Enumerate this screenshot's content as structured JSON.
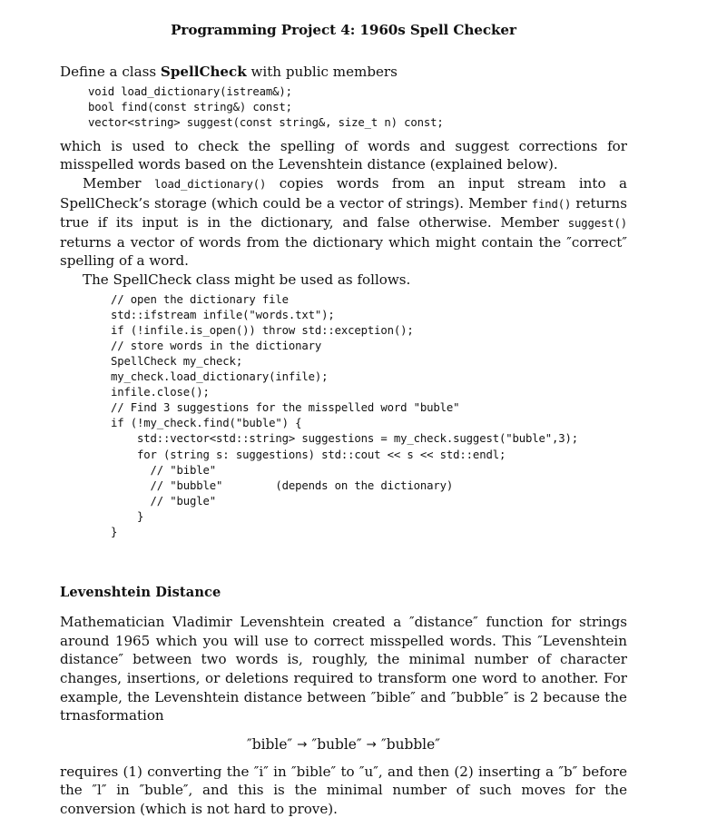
{
  "document": {
    "title": "Programming Project 4: 1960s Spell Checker",
    "intro": {
      "line": "Define a class SpellCheck with public members",
      "lead_prefix": "Define a class ",
      "lead_class_name": "SpellCheck",
      "lead_suffix": " with public members"
    },
    "signature_code": "void load_dictionary(istream&);\nbool find(const string&) const;\nvector<string> suggest(const string&, size_t n) const;",
    "paragraph_which": "which is used to check the spelling of words and suggest corrections for misspelled words based on the Levenshtein distance (explained below).",
    "paragraph_members": {
      "part1": "Member ",
      "code1": "load_dictionary()",
      "part2": " copies words from an input stream into a SpellCheck’s storage (which could be a vector of strings).  Member ",
      "code2": "find()",
      "part3": " returns true if its input is in the dictionary, and false otherwise. Member ",
      "code3": "suggest()",
      "part4": " returns a vector of words from the dictionary which might contain the ″correct″ spelling of a word."
    },
    "paragraph_usage": "The SpellCheck class might be used as follows.",
    "usage_code": "// open the dictionary file\nstd::ifstream infile(\"words.txt\");\nif (!infile.is_open()) throw std::exception();\n// store words in the dictionary\nSpellCheck my_check;\nmy_check.load_dictionary(infile);\ninfile.close();\n// Find 3 suggestions for the misspelled word \"buble\"\nif (!my_check.find(\"buble\") {\n    std::vector<std::string> suggestions = my_check.suggest(\"buble\",3);\n    for (string s: suggestions) std::cout << s << std::endl;\n      // \"bible\"\n      // \"bubble\"        (depends on the dictionary)\n      // \"bugle\"\n    }\n}",
    "section": {
      "heading": "Levenshtein Distance",
      "paragraph1": "Mathematician Vladimir Levenshtein created a ″distance″ function for strings around 1965 which you will use to correct misspelled words. This ″Levenshtein distance″ between two words is, roughly, the minimal number of character changes, insertions, or deletions required to transform one word to another.  For example, the Levenshtein distance between ″bible″ and ″bubble″ is 2 because the trnasformation",
      "formula": {
        "term1": "″bible″",
        "arrow1": "→",
        "term2": "″buble″",
        "arrow2": "→",
        "term3": "″bubble″"
      },
      "paragraph2": "requires (1) converting the ″i″ in ″bible″ to ″u″, and then (2) inserting a ″b″ before the ″l″ in ″buble″, and this is the minimal number of such moves for the conversion (which is not hard to prove)."
    }
  }
}
